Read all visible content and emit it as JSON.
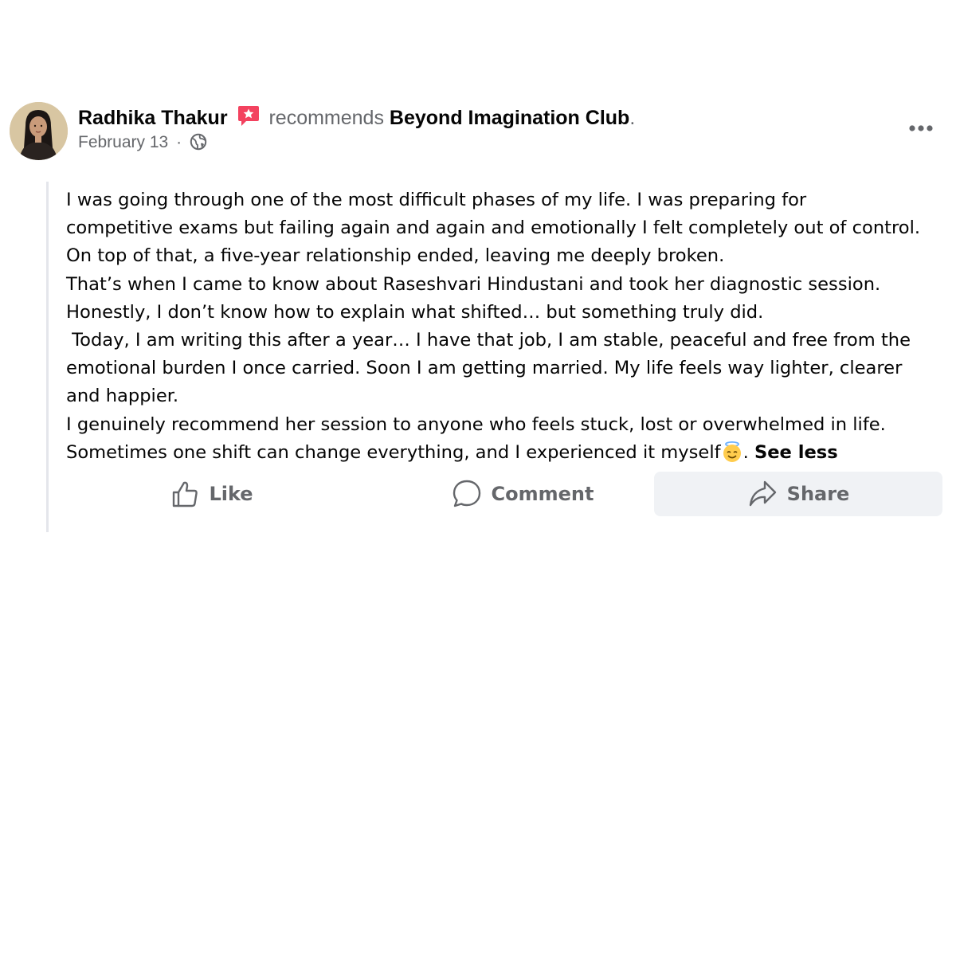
{
  "post": {
    "author": "Radhika Thakur",
    "action_text": "recommends",
    "page_name": "Beyond Imagination Club",
    "period": ".",
    "date": "February 13",
    "date_separator": "·",
    "audience_icon": "globe-icon",
    "more_icon": "ellipsis-icon",
    "body_lines": [
      "I was going through one of the most difficult phases of my life. I was preparing for",
      "competitive exams but failing again and again and emotionally I felt completely out of control.",
      "On top of that, a five-year relationship ended, leaving me deeply broken.",
      "That’s when I came to know about Raseshvari Hindustani and took her diagnostic session.",
      "Honestly, I don’t know how to explain what shifted… but something truly did.",
      " Today, I am writing this after a year… I have that job, I am stable, peaceful and free from the",
      "emotional burden I once carried. Soon I am getting married. My life feels way lighter, clearer",
      "and happier.",
      "I genuinely recommend her session to anyone who feels stuck, lost or overwhelmed in life."
    ],
    "last_line": "Sometimes one shift can change everything, and I experienced it myself",
    "last_line_emoji": "smiling-face-with-halo-icon",
    "last_line_after_emoji": ".",
    "see_less_label": "See less"
  },
  "actions": {
    "like_label": "Like",
    "comment_label": "Comment",
    "share_label": "Share"
  },
  "colors": {
    "secondary_text": "#65676b",
    "primary_text": "#050505",
    "recommend_badge": "#f3425f",
    "share_bg": "#f0f2f5"
  }
}
